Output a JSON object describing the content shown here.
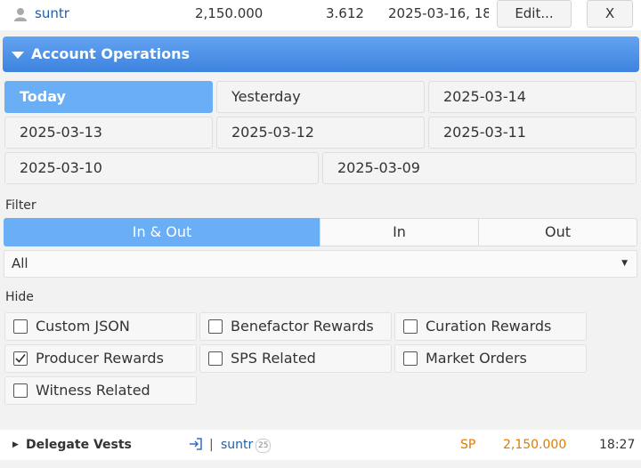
{
  "top_row": {
    "account": "suntr",
    "amount": "2,150.000",
    "ratio": "3.612",
    "datetime": "2025-03-16, 18:",
    "edit_label": "Edit...",
    "remove_label": "X"
  },
  "panel": {
    "title": "Account Operations",
    "dates": [
      "Today",
      "Yesterday",
      "2025-03-14",
      "2025-03-13",
      "2025-03-12",
      "2025-03-11",
      "2025-03-10",
      "2025-03-09"
    ],
    "filter_label": "Filter",
    "filter_options": [
      "In & Out",
      "In",
      "Out"
    ],
    "select_value": "All",
    "hide_label": "Hide",
    "hide_options": [
      {
        "label": "Custom JSON",
        "checked": false
      },
      {
        "label": "Benefactor Rewards",
        "checked": false
      },
      {
        "label": "Curation Rewards",
        "checked": false
      },
      {
        "label": "Producer Rewards",
        "checked": true
      },
      {
        "label": "SPS Related",
        "checked": false
      },
      {
        "label": "Market Orders",
        "checked": false
      },
      {
        "label": "Witness Related",
        "checked": false
      }
    ]
  },
  "operation": {
    "type": "Delegate Vests",
    "separator": "|",
    "account": "suntr",
    "reputation": "25",
    "unit": "SP",
    "amount": "2,150.000",
    "time": "18:27"
  },
  "colors": {
    "accent": "#4a90e2",
    "active": "#6aaff6",
    "orange": "#e07b00",
    "link": "#1f5fa8"
  }
}
